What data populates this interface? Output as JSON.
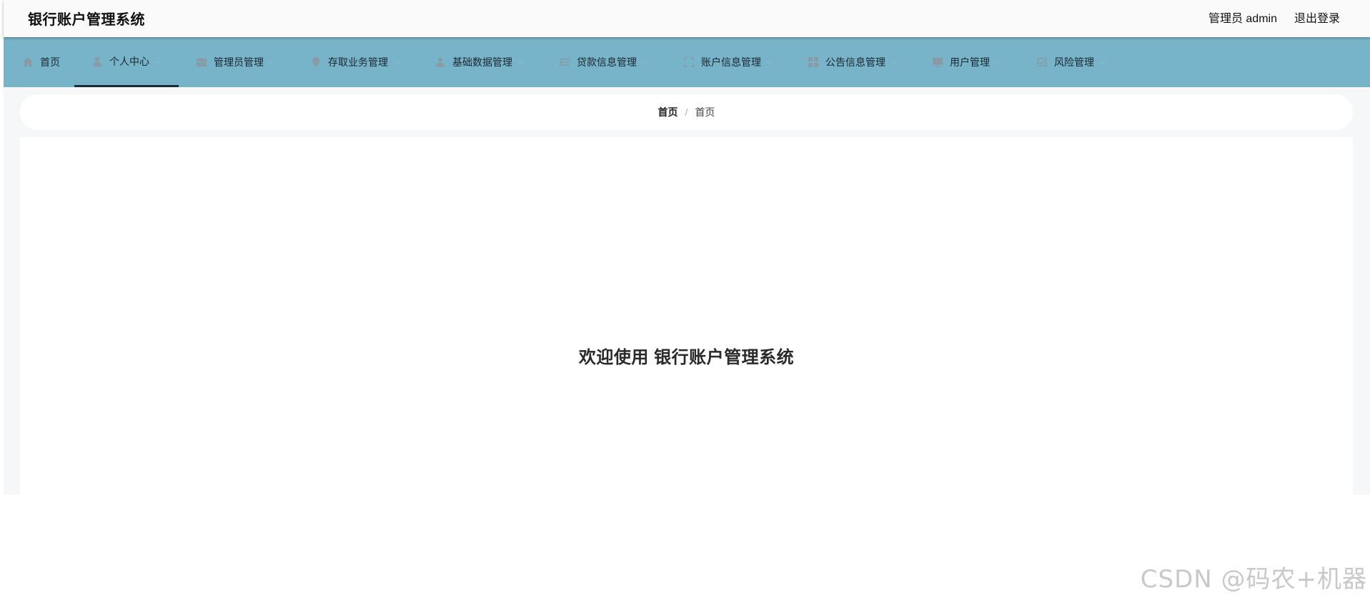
{
  "header": {
    "title": "银行账户管理系统",
    "user_label": "管理员 admin",
    "logout_label": "退出登录"
  },
  "nav": {
    "items": [
      {
        "label": "首页",
        "icon": "home-icon",
        "active": false,
        "has_dropdown": false
      },
      {
        "label": "个人中心",
        "icon": "user-icon",
        "active": true,
        "has_dropdown": true
      },
      {
        "label": "管理员管理",
        "icon": "briefcase-icon",
        "active": false,
        "has_dropdown": true
      },
      {
        "label": "存取业务管理",
        "icon": "location-pin-icon",
        "active": false,
        "has_dropdown": true
      },
      {
        "label": "基础数据管理",
        "icon": "person-icon",
        "active": false,
        "has_dropdown": true
      },
      {
        "label": "贷款信息管理",
        "icon": "sliders-icon",
        "active": false,
        "has_dropdown": true
      },
      {
        "label": "账户信息管理",
        "icon": "fullscreen-icon",
        "active": false,
        "has_dropdown": true
      },
      {
        "label": "公告信息管理",
        "icon": "grid-icon",
        "active": false,
        "has_dropdown": true
      },
      {
        "label": "用户管理",
        "icon": "monitor-icon",
        "active": false,
        "has_dropdown": true
      },
      {
        "label": "风险管理",
        "icon": "checkbox-icon",
        "active": false,
        "has_dropdown": true
      }
    ]
  },
  "breadcrumb": {
    "first": "首页",
    "separator": "/",
    "second": "首页"
  },
  "main": {
    "welcome_text": "欢迎使用 银行账户管理系统"
  },
  "watermark": "CSDN @码农+机器",
  "colors": {
    "navbar_bg": "#77b3c9",
    "header_bg": "#fafafa",
    "page_bg": "#f6f7f9",
    "active_underline": "#1b2a34"
  }
}
